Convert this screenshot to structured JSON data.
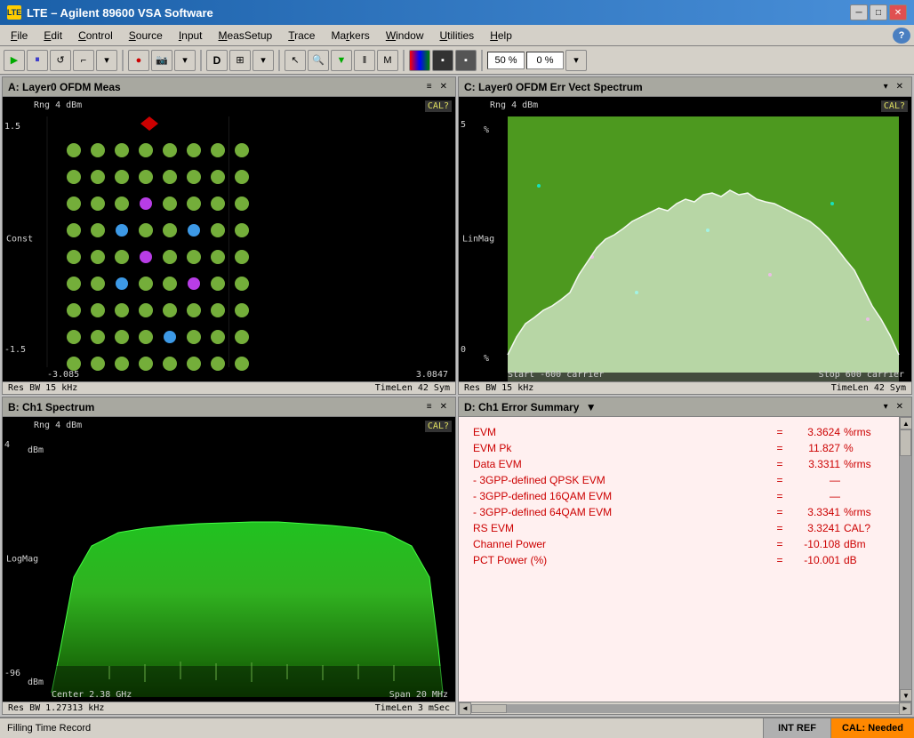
{
  "app": {
    "title": "LTE – Agilent 89600 VSA Software",
    "icon": "LTE"
  },
  "menu": {
    "items": [
      "File",
      "Edit",
      "Control",
      "Source",
      "Input",
      "MeasSetup",
      "Trace",
      "Markers",
      "Window",
      "Utilities",
      "Help"
    ]
  },
  "toolbar": {
    "percent1": "50 %",
    "percent2": "0 %"
  },
  "panels": {
    "a": {
      "title": "A: Layer0 OFDM Meas",
      "rng": "Rng 4 dBm",
      "cal": "CAL?",
      "y_top": "1.5",
      "y_bottom": "-1.5",
      "axis_label": "Const",
      "x_left": "-3.085",
      "x_right": "3.0847",
      "info1": "Res BW 15 kHz",
      "info2": "TimeLen 42  Sym"
    },
    "b": {
      "title": "B: Ch1 Spectrum",
      "rng": "Rng 4 dBm",
      "cal": "CAL?",
      "y_top": "4",
      "y_top_unit": "dBm",
      "y_bottom": "-96",
      "y_bottom_unit": "dBm",
      "axis_label": "LogMag",
      "x_left": "Center 2.38 GHz",
      "x_right": "Span 20 MHz",
      "info1": "Res BW 1.27313 kHz",
      "info2": "TimeLen 3 mSec"
    },
    "c": {
      "title": "C: Layer0 OFDM Err Vect Spectrum",
      "rng": "Rng 4 dBm",
      "cal": "CAL?",
      "y_top": "5",
      "y_top_unit": "%",
      "y_zero": "0",
      "y_bottom_unit": "%",
      "axis_label": "LinMag",
      "x_left": "Start -600 carrier",
      "x_right": "Stop 600 carrier",
      "info1": "Res BW 15 kHz",
      "info2": "TimeLen 42  Sym"
    },
    "d": {
      "title": "D: Ch1 Error Summary",
      "rows": [
        {
          "name": "EVM",
          "eq": "=",
          "val": "3.3624",
          "unit": "%rms"
        },
        {
          "name": "EVM Pk",
          "eq": "=",
          "val": "11.827",
          "unit": "%"
        },
        {
          "name": "Data EVM",
          "eq": "=",
          "val": "3.3311",
          "unit": "%rms"
        },
        {
          "name": "- 3GPP-defined QPSK EVM",
          "eq": "=",
          "val": "—",
          "unit": ""
        },
        {
          "name": "- 3GPP-defined 16QAM EVM",
          "eq": "=",
          "val": "—",
          "unit": ""
        },
        {
          "name": "- 3GPP-defined 64QAM EVM",
          "eq": "=",
          "val": "3.3341",
          "unit": "%rms"
        },
        {
          "name": "RS EVM",
          "eq": "=",
          "val": "3.3241",
          "unit": "CAL?"
        },
        {
          "name": "Channel Power",
          "eq": "=",
          "val": "-10.108",
          "unit": "dBm"
        },
        {
          "name": "PCT Power (%)",
          "eq": "=",
          "val": "-10.001",
          "unit": "dB"
        }
      ]
    }
  },
  "status": {
    "main": "Filling Time Record",
    "intref": "INT REF",
    "cal": "CAL: Needed"
  }
}
